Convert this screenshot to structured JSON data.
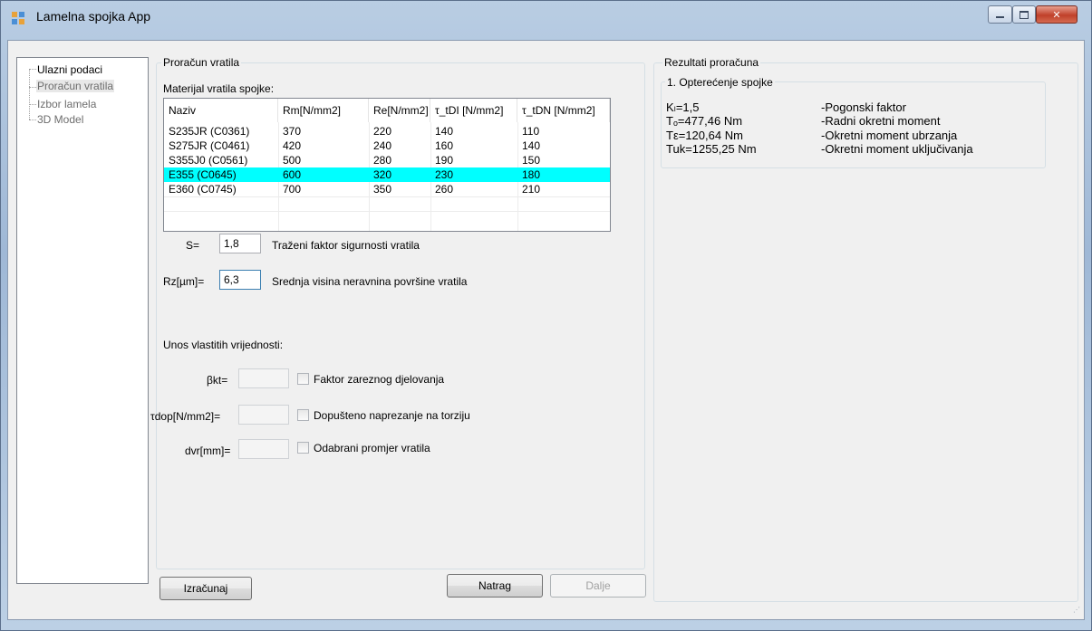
{
  "window": {
    "title": "Lamelna spojka App"
  },
  "tree": {
    "items": [
      {
        "label": "Ulazni podaci",
        "state": "normal"
      },
      {
        "label": "Proračun vratila",
        "state": "selected"
      },
      {
        "label": "Izbor lamela",
        "state": "disabled"
      },
      {
        "label": "3D Model",
        "state": "disabled"
      }
    ]
  },
  "calc": {
    "group_title": "Proračun vratila",
    "material_label": "Materijal vratila spojke:",
    "table": {
      "columns": [
        "Naziv",
        "Rm[N/mm2]",
        "Re[N/mm2]",
        "τ_tDI [N/mm2]",
        "τ_tDN [N/mm2]"
      ],
      "rows": [
        [
          "S235JR (C0361)",
          "370",
          "220",
          "140",
          "110"
        ],
        [
          "S275JR (C0461)",
          "420",
          "240",
          "160",
          "140"
        ],
        [
          "S355J0 (C0561)",
          "500",
          "280",
          "190",
          "150"
        ],
        [
          "E355 (C0645)",
          "600",
          "320",
          "230",
          "180"
        ],
        [
          "E360 (C0745)",
          "700",
          "350",
          "260",
          "210"
        ]
      ],
      "selected_row": 3,
      "selected_color": "#00ffff"
    },
    "s_label": "S=",
    "s_value": "1,8",
    "s_desc": "Traženi faktor sigurnosti vratila",
    "rz_label": "Rz[µm]=",
    "rz_value": "6,3",
    "rz_desc": "Srednja visina neravnina  površine vratila",
    "own_values_title": "Unos vlastitih vrijednosti:",
    "own": [
      {
        "label": "βkt=",
        "value": "",
        "desc": "Faktor zareznog djelovanja"
      },
      {
        "label": "τdop[N/mm2]=",
        "value": "",
        "desc": "Dopušteno naprezanje na torziju"
      },
      {
        "label": "dvr[mm]=",
        "value": "",
        "desc": "Odabrani promjer vratila"
      }
    ]
  },
  "buttons": {
    "calculate": "Izračunaj",
    "back": "Natrag",
    "next": "Dalje"
  },
  "results": {
    "group_title": "Rezultati proračuna",
    "sub_title": "1. Opterećenje spojke",
    "lines": [
      {
        "value": "Kₗ=1,5",
        "desc": "-Pogonski faktor"
      },
      {
        "value": "Tₒ=477,46 Nm",
        "desc": "-Radni okretni moment"
      },
      {
        "value": "Tε=120,64 Nm",
        "desc": "-Okretni moment ubrzanja"
      },
      {
        "value": "Tuk=1255,25 Nm",
        "desc": "-Okretni moment uključivanja"
      }
    ]
  },
  "icons": {
    "app": "app-icon",
    "minimize": "minimize-icon",
    "maximize": "maximize-icon",
    "close": "close-icon"
  }
}
